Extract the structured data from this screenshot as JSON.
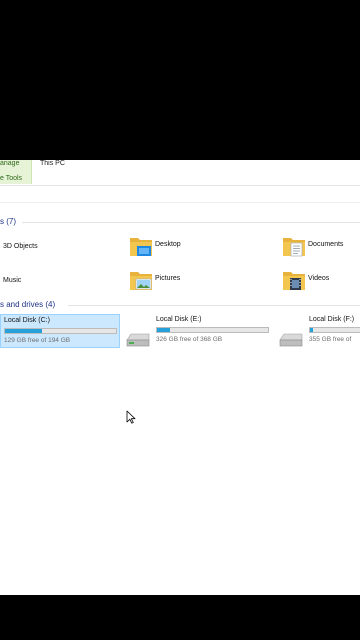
{
  "ribbon": {
    "manage_label": "anage",
    "tools_label": "e Tools",
    "thispc_label": "This PC"
  },
  "groups": {
    "folders_header": "s (7)",
    "drives_header": "s and drives (4)"
  },
  "folders": [
    {
      "label": "3D Objects",
      "icon": "3d-objects-icon"
    },
    {
      "label": "Desktop",
      "icon": "desktop-folder-icon"
    },
    {
      "label": "Documents",
      "icon": "documents-folder-icon"
    },
    {
      "label": "Music",
      "icon": "music-folder-icon"
    },
    {
      "label": "Pictures",
      "icon": "pictures-folder-icon"
    },
    {
      "label": "Videos",
      "icon": "videos-folder-icon"
    }
  ],
  "drives": [
    {
      "name": "Local Disk (C:)",
      "free_text": "129 GB free of 194 GB",
      "used_fraction": 0.335,
      "selected": true
    },
    {
      "name": "Local Disk (E:)",
      "free_text": "326 GB free of 368 GB",
      "used_fraction": 0.114,
      "selected": false
    },
    {
      "name": "Local Disk (F:)",
      "free_text": "355 GB free of",
      "used_fraction": 0.03,
      "selected": false
    }
  ],
  "colors": {
    "bar_fill": "#26a0da",
    "selection": "#cce8ff",
    "header_text": "#1e3287",
    "folder_yellow": "#f3c74f"
  }
}
